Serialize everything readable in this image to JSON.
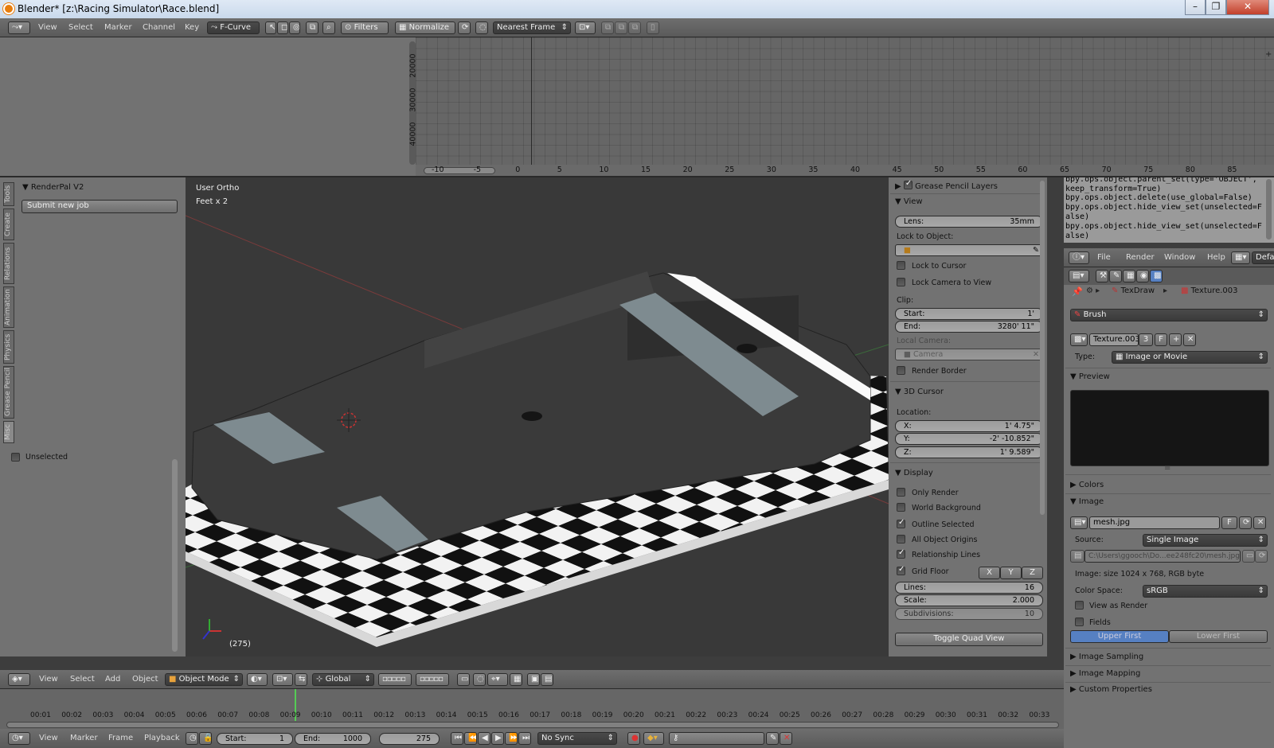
{
  "window": {
    "title": "Blender* [z:\\Racing Simulator\\Race.blend]"
  },
  "graph_editor": {
    "menus": [
      "View",
      "Select",
      "Marker",
      "Channel",
      "Key"
    ],
    "mode": "F-Curve",
    "filters_label": "Filters",
    "normalize_label": "Normalize",
    "snap_mode": "Nearest Frame",
    "y_ticks": [
      "40000",
      "30000",
      "20000"
    ],
    "x_ticks": [
      "-10",
      "-5",
      "0",
      "5",
      "10",
      "15",
      "20",
      "25",
      "30",
      "35",
      "40",
      "45",
      "50",
      "55",
      "60",
      "65",
      "70",
      "75",
      "80",
      "85"
    ]
  },
  "tool_shelf": {
    "tabs": [
      "Tools",
      "Create",
      "Relations",
      "Animation",
      "Physics",
      "Grease Pencil",
      "Misc"
    ],
    "panel_title": "RenderPal V2",
    "submit_label": "Submit new job",
    "unselected_label": "Unselected"
  },
  "viewport": {
    "view_name": "User Ortho",
    "units": "Feet x 2",
    "frame_label": "(275)",
    "menus": [
      "View",
      "Select",
      "Add",
      "Object"
    ],
    "mode": "Object Mode",
    "orientation": "Global"
  },
  "properties_n": {
    "grease_pencil": "Grease Pencil Layers",
    "view": {
      "title": "View",
      "lens_label": "Lens:",
      "lens_value": "35mm",
      "lock_to_object": "Lock to Object:",
      "lock_to_cursor": "Lock to Cursor",
      "lock_camera": "Lock Camera to View",
      "clip": "Clip:",
      "start_label": "Start:",
      "start_value": "1'",
      "end_label": "End:",
      "end_value": "3280' 11\"",
      "local_camera": "Local Camera:",
      "camera_placeholder": "Camera",
      "render_border": "Render Border"
    },
    "cursor": {
      "title": "3D Cursor",
      "location": "Location:",
      "x_label": "X:",
      "x_value": "1' 4.75\"",
      "y_label": "Y:",
      "y_value": "-2' -10.852\"",
      "z_label": "Z:",
      "z_value": "1' 9.589\""
    },
    "display": {
      "title": "Display",
      "only_render": "Only Render",
      "world_background": "World Background",
      "outline_selected": "Outline Selected",
      "all_object_origins": "All Object Origins",
      "relationship_lines": "Relationship Lines",
      "grid_floor": "Grid Floor",
      "axes": [
        "X",
        "Y",
        "Z"
      ],
      "lines_label": "Lines:",
      "lines_value": "16",
      "scale_label": "Scale:",
      "scale_value": "2.000",
      "subdiv_label": "Subdivisions:",
      "subdiv_value": "10",
      "toggle_quad": "Toggle Quad View"
    }
  },
  "python_console": {
    "lines": [
      "bpy.ops.object.parent_set(type='OBJECT', keep_transform=True)",
      "bpy.ops.object.delete(use_global=False)",
      "bpy.ops.object.hide_view_set(unselected=False)",
      "bpy.ops.object.hide_view_set(unselected=False)"
    ]
  },
  "info_header": {
    "menus": [
      "File",
      "Render",
      "Window",
      "Help"
    ],
    "layout": "Defa"
  },
  "texture_props": {
    "breadcrumb_brush": "TexDraw",
    "breadcrumb_tex": "Texture.003",
    "brush_label": "Brush",
    "texture_name": "Texture.003",
    "users": "3",
    "fake": "F",
    "type_label": "Type:",
    "type_value": "Image or Movie",
    "preview": "Preview",
    "colors": "Colors",
    "image": "Image",
    "image_name": "mesh.jpg",
    "source_label": "Source:",
    "source_value": "Single Image",
    "filepath": "C:\\Users\\ggooch\\Do...ee248fc20\\mesh.jpg",
    "image_info": "Image: size 1024 x 768, RGB byte",
    "color_space_label": "Color Space:",
    "color_space_value": "sRGB",
    "view_as_render": "View as Render",
    "fields": "Fields",
    "upper_first": "Upper First",
    "lower_first": "Lower First",
    "image_sampling": "Image Sampling",
    "image_mapping": "Image Mapping",
    "custom_properties": "Custom Properties"
  },
  "timeline": {
    "ticks": [
      "00:01",
      "00:02",
      "00:03",
      "00:04",
      "00:05",
      "00:06",
      "00:07",
      "00:08",
      "00:09",
      "00:10",
      "00:11",
      "00:12",
      "00:13",
      "00:14",
      "00:15",
      "00:16",
      "00:17",
      "00:18",
      "00:19",
      "00:20",
      "00:21",
      "00:22",
      "00:23",
      "00:24",
      "00:25",
      "00:26",
      "00:27",
      "00:28",
      "00:29",
      "00:30",
      "00:31",
      "00:32",
      "00:33"
    ],
    "menus": [
      "View",
      "Marker",
      "Frame",
      "Playback"
    ],
    "start_label": "Start:",
    "start_value": "1",
    "end_label": "End:",
    "end_value": "1000",
    "current_frame": "275",
    "sync": "No Sync"
  }
}
